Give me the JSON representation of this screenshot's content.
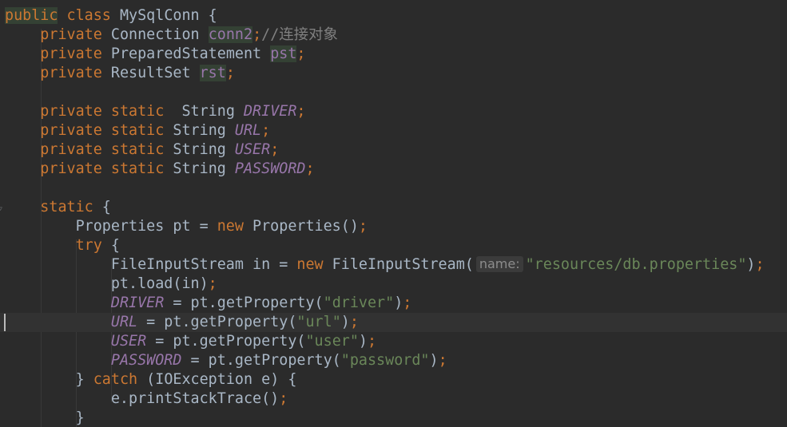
{
  "editor": {
    "lines": [
      [
        {
          "t": "public",
          "c": "usage-kw"
        },
        {
          "t": " "
        },
        {
          "t": "class",
          "c": "kw"
        },
        {
          "t": " MySqlConn {"
        }
      ],
      [
        {
          "t": "    "
        },
        {
          "t": "private",
          "c": "kw"
        },
        {
          "t": " Connection "
        },
        {
          "t": "conn2",
          "c": "field usage"
        },
        {
          "t": ";",
          "c": "kw"
        },
        {
          "t": "//连接对象",
          "c": "comment"
        }
      ],
      [
        {
          "t": "    "
        },
        {
          "t": "private",
          "c": "kw"
        },
        {
          "t": " PreparedStatement "
        },
        {
          "t": "pst",
          "c": "field usage"
        },
        {
          "t": ";",
          "c": "kw"
        }
      ],
      [
        {
          "t": "    "
        },
        {
          "t": "private",
          "c": "kw"
        },
        {
          "t": " ResultSet "
        },
        {
          "t": "rst",
          "c": "field usage"
        },
        {
          "t": ";",
          "c": "kw"
        }
      ],
      [],
      [
        {
          "t": "    "
        },
        {
          "t": "private",
          "c": "kw"
        },
        {
          "t": " "
        },
        {
          "t": "static",
          "c": "kw"
        },
        {
          "t": "  String "
        },
        {
          "t": "DRIVER",
          "c": "sfield"
        },
        {
          "t": ";",
          "c": "kw"
        }
      ],
      [
        {
          "t": "    "
        },
        {
          "t": "private",
          "c": "kw"
        },
        {
          "t": " "
        },
        {
          "t": "static",
          "c": "kw"
        },
        {
          "t": " String "
        },
        {
          "t": "URL",
          "c": "sfield"
        },
        {
          "t": ";",
          "c": "kw"
        }
      ],
      [
        {
          "t": "    "
        },
        {
          "t": "private",
          "c": "kw"
        },
        {
          "t": " "
        },
        {
          "t": "static",
          "c": "kw"
        },
        {
          "t": " String "
        },
        {
          "t": "USER",
          "c": "sfield"
        },
        {
          "t": ";",
          "c": "kw"
        }
      ],
      [
        {
          "t": "    "
        },
        {
          "t": "private",
          "c": "kw"
        },
        {
          "t": " "
        },
        {
          "t": "static",
          "c": "kw"
        },
        {
          "t": " String "
        },
        {
          "t": "PASSWORD",
          "c": "sfield"
        },
        {
          "t": ";",
          "c": "kw"
        }
      ],
      [],
      [
        {
          "t": "    "
        },
        {
          "t": "static",
          "c": "kw"
        },
        {
          "t": " {"
        }
      ],
      [
        {
          "t": "        Properties pt = "
        },
        {
          "t": "new",
          "c": "kw"
        },
        {
          "t": " Properties()"
        },
        {
          "t": ";",
          "c": "kw"
        }
      ],
      [
        {
          "t": "        "
        },
        {
          "t": "try",
          "c": "kw"
        },
        {
          "t": " {"
        }
      ],
      [
        {
          "t": "            FileInputStream in = "
        },
        {
          "t": "new",
          "c": "kw"
        },
        {
          "t": " FileInputStream("
        },
        {
          "t": "name:",
          "c": "hint"
        },
        {
          "t": "\"resources/db.properties\"",
          "c": "str"
        },
        {
          "t": ")"
        },
        {
          "t": ";",
          "c": "kw"
        }
      ],
      [
        {
          "t": "            pt.load(in)"
        },
        {
          "t": ";",
          "c": "kw"
        }
      ],
      [
        {
          "t": "            "
        },
        {
          "t": "DRIVER",
          "c": "sfield"
        },
        {
          "t": " = pt.getProperty("
        },
        {
          "t": "\"driver\"",
          "c": "str"
        },
        {
          "t": ")"
        },
        {
          "t": ";",
          "c": "kw"
        }
      ],
      [
        {
          "t": "            "
        },
        {
          "t": "URL",
          "c": "sfield"
        },
        {
          "t": " = pt.getProperty("
        },
        {
          "t": "\"url\"",
          "c": "str"
        },
        {
          "t": ")"
        },
        {
          "t": ";",
          "c": "kw"
        }
      ],
      [
        {
          "t": "            "
        },
        {
          "t": "USER",
          "c": "sfield"
        },
        {
          "t": " = pt.getProperty("
        },
        {
          "t": "\"user\"",
          "c": "str"
        },
        {
          "t": ")"
        },
        {
          "t": ";",
          "c": "kw"
        }
      ],
      [
        {
          "t": "            "
        },
        {
          "t": "PASSWORD",
          "c": "sfield"
        },
        {
          "t": " = pt.getProperty("
        },
        {
          "t": "\"password\"",
          "c": "str"
        },
        {
          "t": ")"
        },
        {
          "t": ";",
          "c": "kw"
        }
      ],
      [
        {
          "t": "        } "
        },
        {
          "t": "catch",
          "c": "kw"
        },
        {
          "t": " (IOException e) {"
        }
      ],
      [
        {
          "t": "            e.printStackTrace()"
        },
        {
          "t": ";",
          "c": "kw"
        }
      ],
      [
        {
          "t": "        }"
        }
      ]
    ],
    "current_line": 16,
    "colors": {
      "background": "#2b2b2b",
      "text": "#a9b7c6",
      "keyword": "#cc7832",
      "field": "#9876aa",
      "string": "#6a8759",
      "comment": "#808080",
      "usage_highlight": "#344134",
      "current_line": "#323232"
    }
  }
}
